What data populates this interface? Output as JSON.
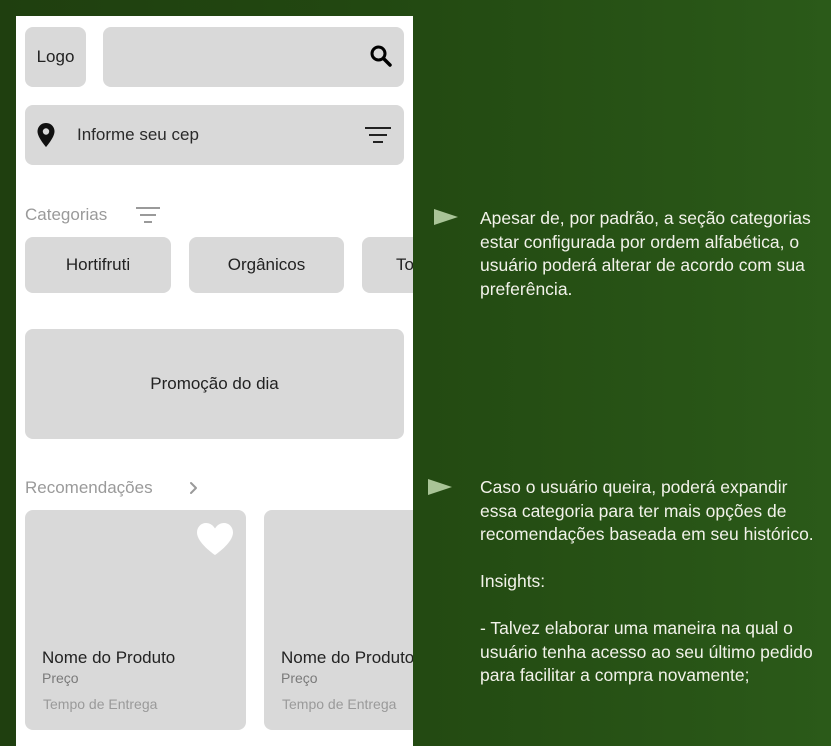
{
  "header": {
    "logo_label": "Logo",
    "search_placeholder": "",
    "cep_label": "Informe seu cep"
  },
  "categories": {
    "title": "Categorias",
    "items": [
      "Hortifruti",
      "Orgânicos",
      "To"
    ]
  },
  "promo": {
    "label": "Promoção do dia"
  },
  "recommendations": {
    "title": "Recomendações",
    "cards": [
      {
        "name": "Nome do Produto",
        "price": "Preço",
        "delivery": "Tempo de Entrega"
      },
      {
        "name": "Nome do Produto",
        "price": "Preço",
        "delivery": "Tempo de Entrega"
      }
    ]
  },
  "annotations": {
    "categories_note": "Apesar de, por padrão, a seção categorias estar configurada por ordem alfabética, o usuário poderá alterar de acordo com sua preferência.",
    "recommendations_note": "Caso o usuário queira, poderá expandir essa categoria para ter mais opções de recomendações baseada em seu histórico.\n\nInsights:\n\n- Talvez elaborar uma maneira na qual o usuário tenha acesso ao seu último pedido para facilitar a compra novamente;"
  },
  "colors": {
    "background_dark": "#1f3f0f",
    "background_light": "#2b5a19",
    "placeholder_gray": "#d9d9d9",
    "arrow_green": "#6f9a5a"
  }
}
